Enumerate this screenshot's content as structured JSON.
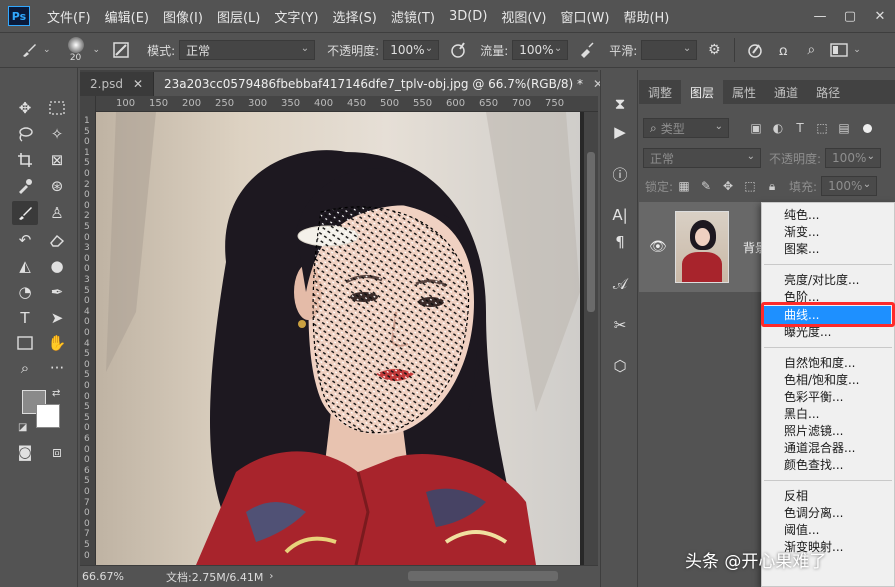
{
  "app": {
    "logo": "Ps"
  },
  "menu": [
    "文件(F)",
    "编辑(E)",
    "图像(I)",
    "图层(L)",
    "文字(Y)",
    "选择(S)",
    "滤镜(T)",
    "3D(D)",
    "视图(V)",
    "窗口(W)",
    "帮助(H)"
  ],
  "window_controls": {
    "minimize": "—",
    "maximize": "▢",
    "close": "✕"
  },
  "options": {
    "brush_size": "20",
    "mode_label": "模式:",
    "mode_value": "正常",
    "opacity_label": "不透明度:",
    "opacity_value": "100%",
    "flow_label": "流量:",
    "flow_value": "100%",
    "smoothing_label": "平滑:",
    "smoothing_value": ""
  },
  "tabs": [
    {
      "label": "2.psd",
      "close": "✕"
    },
    {
      "label": "23a203cc0579486fbebbaf417146dfe7_tplv-obj.jpg @ 66.7%(RGB/8) *",
      "close": "✕"
    }
  ],
  "ruler": {
    "top": [
      "100",
      "150",
      "200",
      "250",
      "300",
      "350",
      "400",
      "450",
      "500",
      "550",
      "600",
      "650",
      "700",
      "750"
    ],
    "left": [
      "1",
      "5",
      "0",
      "1",
      "5",
      "0",
      "2",
      "0",
      "0",
      "2",
      "5",
      "0",
      "3",
      "0",
      "0",
      "3",
      "5",
      "0",
      "4",
      "0",
      "0",
      "4",
      "5",
      "0",
      "5",
      "0",
      "0",
      "5",
      "5",
      "0",
      "6",
      "0",
      "0",
      "6",
      "5",
      "0",
      "7",
      "0",
      "0",
      "7",
      "5",
      "0"
    ]
  },
  "status": {
    "zoom": "66.67%",
    "doc": "文档:2.75M/6.41M"
  },
  "layers_panel": {
    "tabs": [
      "调整",
      "图层",
      "属性",
      "通道",
      "路径"
    ],
    "active_tab": 1,
    "kind_filter": "类型",
    "blend_mode": "正常",
    "opacity_label": "不透明度:",
    "opacity_value": "100%",
    "lock_label": "锁定:",
    "fill_label": "填充:",
    "fill_value": "100%",
    "layer_name": "背景"
  },
  "context_menu": {
    "group1": [
      "纯色...",
      "渐变...",
      "图案..."
    ],
    "group2": [
      "亮度/对比度...",
      "色阶...",
      "曲线...",
      "曝光度..."
    ],
    "group3": [
      "自然饱和度...",
      "色相/饱和度...",
      "色彩平衡...",
      "黑白...",
      "照片滤镜...",
      "通道混合器...",
      "颜色查找..."
    ],
    "group4": [
      "反相",
      "色调分离...",
      "阈值...",
      "渐变映射..."
    ],
    "highlighted": "曲线..."
  },
  "watermark": "头条 @开心果难了",
  "colors": {
    "highlight": "#1e90ff",
    "red_box": "#ff2a2a",
    "ui_bg": "#535353"
  }
}
